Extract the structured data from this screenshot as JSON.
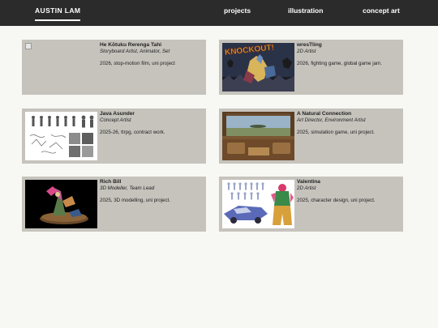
{
  "nav": {
    "brand": "AUSTIN LAM",
    "links": [
      "projects",
      "illustration",
      "concept art"
    ]
  },
  "projects": [
    {
      "title": "He Kōtuku Rerenga Tahi",
      "role": "Storyboard Artist, Animator, Set",
      "description": "2026, stop-motion film, uni project",
      "thumb_icon": "broken-image-icon"
    },
    {
      "title": "wresTling",
      "role": "2D Artist",
      "description": "2026, fighting game, global game jam.",
      "thumb_text": "KNOCKOUT!"
    },
    {
      "title": "Java Asunder",
      "role": "Concept Artist",
      "description": "2025-26, ttrpg, contract work."
    },
    {
      "title": "A Natural Connection",
      "role": "Art Director, Environment Artist",
      "description": "2025, simulation game, uni project."
    },
    {
      "title": "Rich Bill",
      "role": "3D Modeller, Team Lead",
      "description": "2025, 3D modelling, uni project."
    },
    {
      "title": "Valentina",
      "role": "2D Artist",
      "description": "2025, character design, uni project."
    }
  ]
}
